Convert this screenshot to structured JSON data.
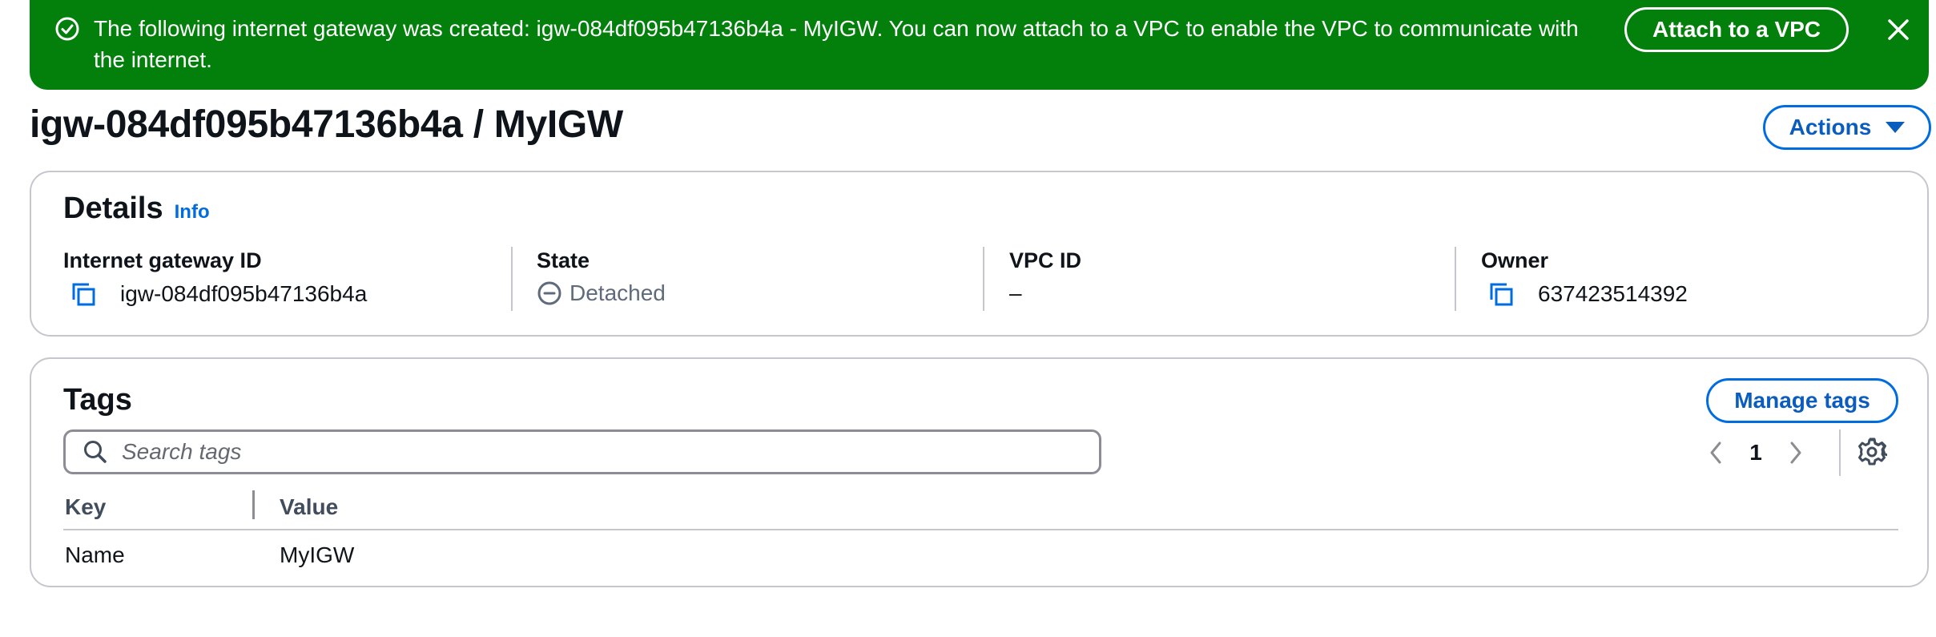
{
  "flash": {
    "message": "The following internet gateway was created: igw-084df095b47136b4a - MyIGW. You can now attach to a VPC to enable the VPC to communicate with the internet.",
    "action_label": "Attach to a VPC",
    "icon": "success-check-icon",
    "dismiss_icon": "close-icon",
    "color": "#037f0c"
  },
  "header": {
    "title": "igw-084df095b47136b4a / MyIGW",
    "actions_label": "Actions"
  },
  "details": {
    "heading": "Details",
    "info_label": "Info",
    "fields": [
      {
        "label": "Internet gateway ID",
        "value": "igw-084df095b47136b4a"
      },
      {
        "label": "State",
        "value": "Detached"
      },
      {
        "label": "VPC ID",
        "value": "–"
      },
      {
        "label": "Owner",
        "value": "637423514392"
      }
    ]
  },
  "tags": {
    "heading": "Tags",
    "manage_label": "Manage tags",
    "search_placeholder": "Search tags",
    "page": "1",
    "columns": [
      "Key",
      "Value"
    ],
    "rows": [
      {
        "key": "Name",
        "value": "MyIGW"
      }
    ]
  },
  "colors": {
    "accent": "#006ce0",
    "success": "#037f0c",
    "border": "#c6c6cd"
  }
}
